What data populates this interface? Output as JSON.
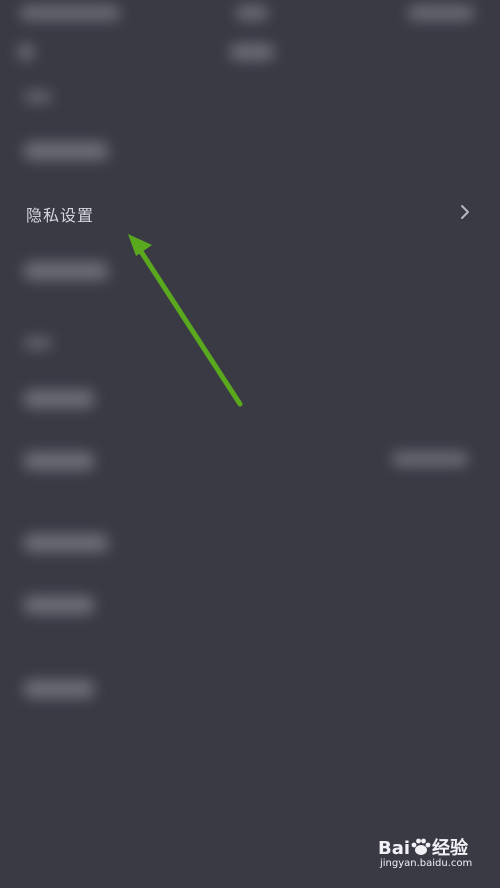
{
  "settings": {
    "privacy_label": "隐私设置"
  },
  "watermark": {
    "brand": "Bai",
    "brand_suffix": "经验",
    "url": "jingyan.baidu.com"
  },
  "colors": {
    "background": "#3a3a45",
    "arrow": "#5aa81e",
    "text": "#d6d6de"
  },
  "icons": {
    "chevron": "chevron-right-icon",
    "paw": "baidu-paw-icon"
  }
}
